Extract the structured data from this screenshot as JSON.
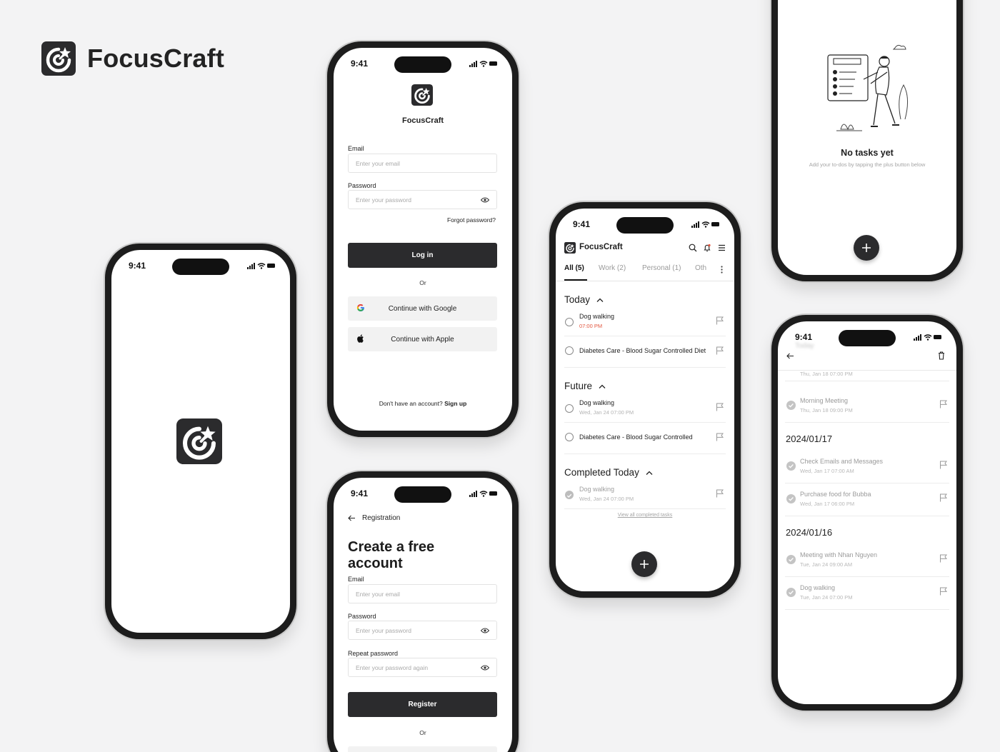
{
  "brand": {
    "name": "FocusCraft"
  },
  "status_time": "9:41",
  "login": {
    "app_name": "FocusCraft",
    "email_label": "Email",
    "email_placeholder": "Enter your email",
    "password_label": "Password",
    "password_placeholder": "Enter your password",
    "forgot": "Forgot password?",
    "login_button": "Log in",
    "or": "Or",
    "google": "Continue with Google",
    "apple": "Continue with Apple",
    "no_account": "Don't have an account?",
    "signup": "Sign up"
  },
  "register": {
    "back_title": "Registration",
    "heading_line1": "Create a free",
    "heading_line2": "account",
    "email_label": "Email",
    "email_placeholder": "Enter your email",
    "password_label": "Password",
    "password_placeholder": "Enter your password",
    "repeat_label": "Repeat password",
    "repeat_placeholder": "Enter your password again",
    "register_button": "Register",
    "or": "Or"
  },
  "tasks": {
    "app_name": "FocusCraft",
    "tabs": [
      {
        "label": "All (5)"
      },
      {
        "label": "Work (2)"
      },
      {
        "label": "Personal (1)"
      },
      {
        "label": "Oth"
      }
    ],
    "today_title": "Today",
    "today": [
      {
        "name": "Dog walking",
        "sub": "07:00 PM"
      },
      {
        "name": "Diabetes Care - Blood Sugar Controlled Diet"
      }
    ],
    "future_title": "Future",
    "future": [
      {
        "name": "Dog walking",
        "sub": "Wed, Jan 24   07:00 PM"
      },
      {
        "name": "Diabetes Care - Blood Sugar Controlled"
      }
    ],
    "completed_title": "Completed Today",
    "completed": [
      {
        "name": "Dog walking",
        "sub": "Wed, Jan 24   07:00 PM"
      }
    ],
    "view_all": "View all completed tasks"
  },
  "empty": {
    "title": "No tasks yet",
    "subtitle": "Add your to-dos by tapping the plus button below"
  },
  "history": {
    "blurred_title": "Today",
    "top_sub": "Thu, Jan 18   07:00 PM",
    "rows_a": [
      {
        "name": "Morning Meeting",
        "sub": "Thu, Jan 18   09:00 PM"
      }
    ],
    "date1": "2024/01/17",
    "rows_b": [
      {
        "name": "Check Emails and Messages",
        "sub": "Wed, Jan 17   07:00 AM"
      },
      {
        "name": "Purchase food for Bubba",
        "sub": "Wed, Jan 17   06:00 PM"
      }
    ],
    "date2": "2024/01/16",
    "rows_c": [
      {
        "name": "Meeting with Nhan Nguyen",
        "sub": "Tue, Jan 24   09:00 AM"
      },
      {
        "name": "Dog walking",
        "sub": "Tue, Jan 24   07:00 PM"
      }
    ]
  },
  "colors": {
    "dark": "#2b2b2d",
    "accent_red": "#e2553e",
    "background": "#f3f3f4"
  }
}
